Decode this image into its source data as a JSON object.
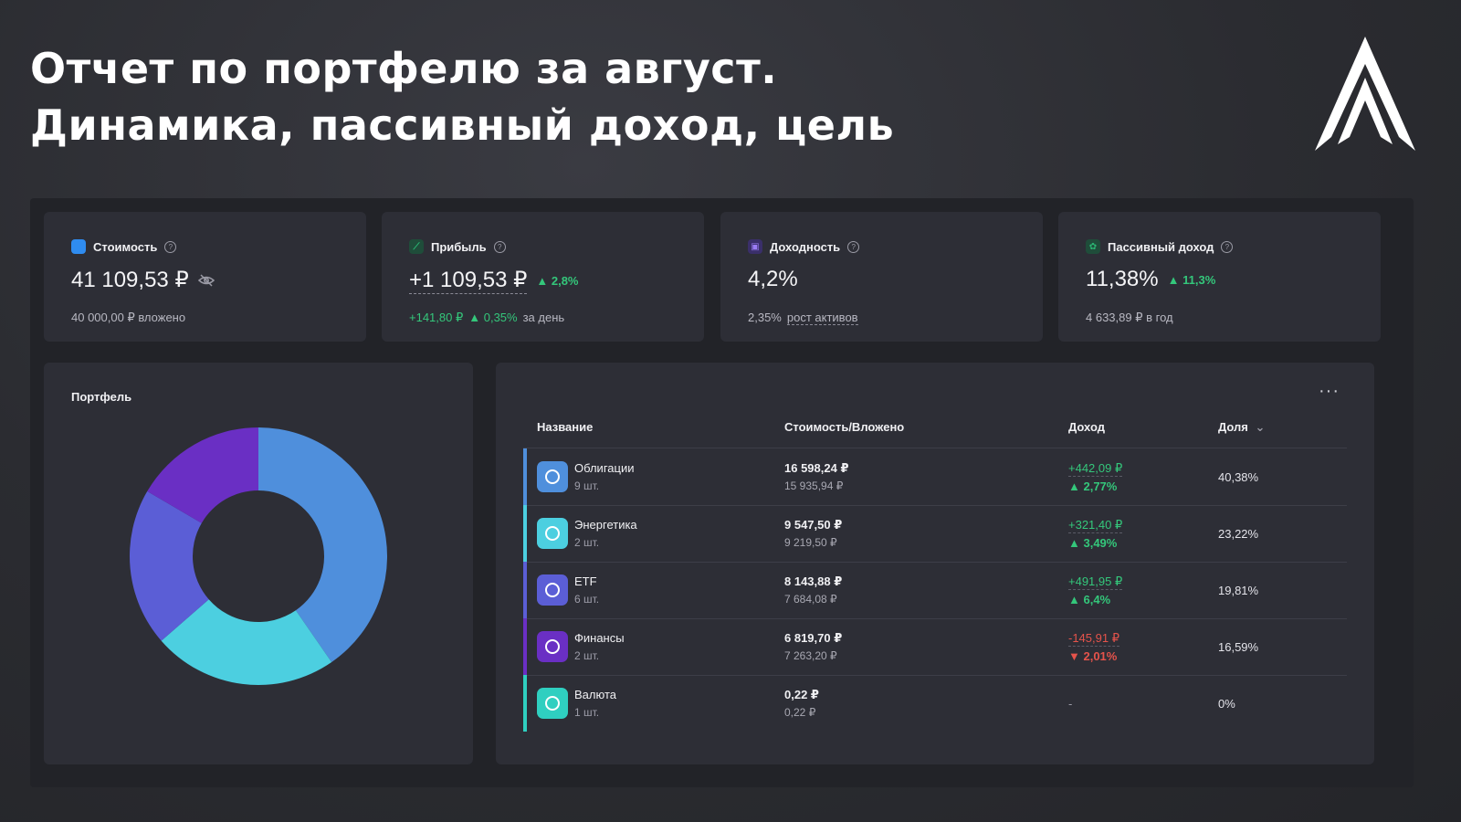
{
  "headline": {
    "line1": "Отчет по портфелю за август.",
    "line2": "Динамика, пассивный доход, цель"
  },
  "kpis": [
    {
      "label": "Стоимость",
      "icon": "square-icon",
      "color": "#2f8cf0",
      "value": "41 109,53 ₽",
      "sub": "40 000,00 ₽ вложено"
    },
    {
      "label": "Прибыль",
      "icon": "chart-up-icon",
      "color": "#2bb673",
      "value": "+1 109,53 ₽",
      "change": "▲ 2,8%",
      "sub_value": "+141,80 ₽",
      "sub_change": "▲ 0,35%",
      "sub_text": "за день"
    },
    {
      "label": "Доходность",
      "icon": "calendar-icon",
      "color": "#7b5cf0",
      "value": "4,2%",
      "sub_value": "2,35%",
      "sub_text": "рост активов"
    },
    {
      "label": "Пассивный доход",
      "icon": "gift-icon",
      "color": "#2bb673",
      "value": "11,38%",
      "change": "▲ 11,3%",
      "sub": "4 633,89 ₽ в год"
    }
  ],
  "portfolio": {
    "title": "Портфель",
    "more": "···"
  },
  "table": {
    "headers": [
      "Название",
      "Стоимость/Вложено",
      "Доход",
      "Доля"
    ],
    "sort_icon": "⌄",
    "rows": [
      {
        "name": "Облигации",
        "qty": "9 шт.",
        "value": "16 598,24 ₽",
        "invested": "15 935,94 ₽",
        "income": "+442,09 ₽",
        "income_pct": "▲ 2,77%",
        "share": "40,38%",
        "color": "#4f8fdc",
        "dir": "up"
      },
      {
        "name": "Энергетика",
        "qty": "2 шт.",
        "value": "9 547,50 ₽",
        "invested": "9 219,50 ₽",
        "income": "+321,40 ₽",
        "income_pct": "▲ 3,49%",
        "share": "23,22%",
        "color": "#4ccfe0",
        "dir": "up"
      },
      {
        "name": "ETF",
        "qty": "6 шт.",
        "value": "8 143,88 ₽",
        "invested": "7 684,08 ₽",
        "income": "+491,95 ₽",
        "income_pct": "▲ 6,4%",
        "share": "19,81%",
        "color": "#5b5ed6",
        "dir": "up"
      },
      {
        "name": "Финансы",
        "qty": "2 шт.",
        "value": "6 819,70 ₽",
        "invested": "7 263,20 ₽",
        "income": "-145,91 ₽",
        "income_pct": "▼ 2,01%",
        "share": "16,59%",
        "color": "#6a2fc4",
        "dir": "down"
      },
      {
        "name": "Валюта",
        "qty": "1 шт.",
        "value": "0,22 ₽",
        "invested": "0,22 ₽",
        "income": "-",
        "income_pct": "",
        "share": "0%",
        "color": "#2fcfc0",
        "dir": "none"
      }
    ]
  },
  "chart_data": {
    "type": "pie",
    "categories": [
      "Облигации",
      "Энергетика",
      "ETF",
      "Финансы",
      "Валюта"
    ],
    "values": [
      40.38,
      23.22,
      19.81,
      16.59,
      0
    ],
    "colors": [
      "#4f8fdc",
      "#4ccfe0",
      "#5b5ed6",
      "#6a2fc4",
      "#2fcfc0"
    ],
    "donut": true
  }
}
